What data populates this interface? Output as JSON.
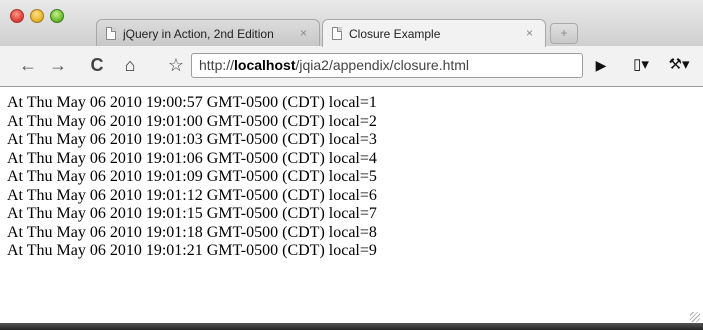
{
  "tabs": [
    {
      "label": "jQuery in Action, 2nd Edition",
      "close": "×"
    },
    {
      "label": "Closure Example",
      "close": "×"
    }
  ],
  "newtab_glyph": "+",
  "toolbar": {
    "back_glyph": "←",
    "forward_glyph": "→",
    "reload_glyph": "C",
    "home_glyph": "⌂",
    "bookmark_glyph": "☆",
    "play_glyph": "▶",
    "page_glyph": "▯▾",
    "wrench_glyph": "⚒▾"
  },
  "address": {
    "prefix": "http://",
    "host": "localhost",
    "path": "/jqia2/appendix/closure.html"
  },
  "lines": [
    "At Thu May 06 2010 19:00:57 GMT-0500 (CDT) local=1",
    "At Thu May 06 2010 19:01:00 GMT-0500 (CDT) local=2",
    "At Thu May 06 2010 19:01:03 GMT-0500 (CDT) local=3",
    "At Thu May 06 2010 19:01:06 GMT-0500 (CDT) local=4",
    "At Thu May 06 2010 19:01:09 GMT-0500 (CDT) local=5",
    "At Thu May 06 2010 19:01:12 GMT-0500 (CDT) local=6",
    "At Thu May 06 2010 19:01:15 GMT-0500 (CDT) local=7",
    "At Thu May 06 2010 19:01:18 GMT-0500 (CDT) local=8",
    "At Thu May 06 2010 19:01:21 GMT-0500 (CDT) local=9"
  ]
}
